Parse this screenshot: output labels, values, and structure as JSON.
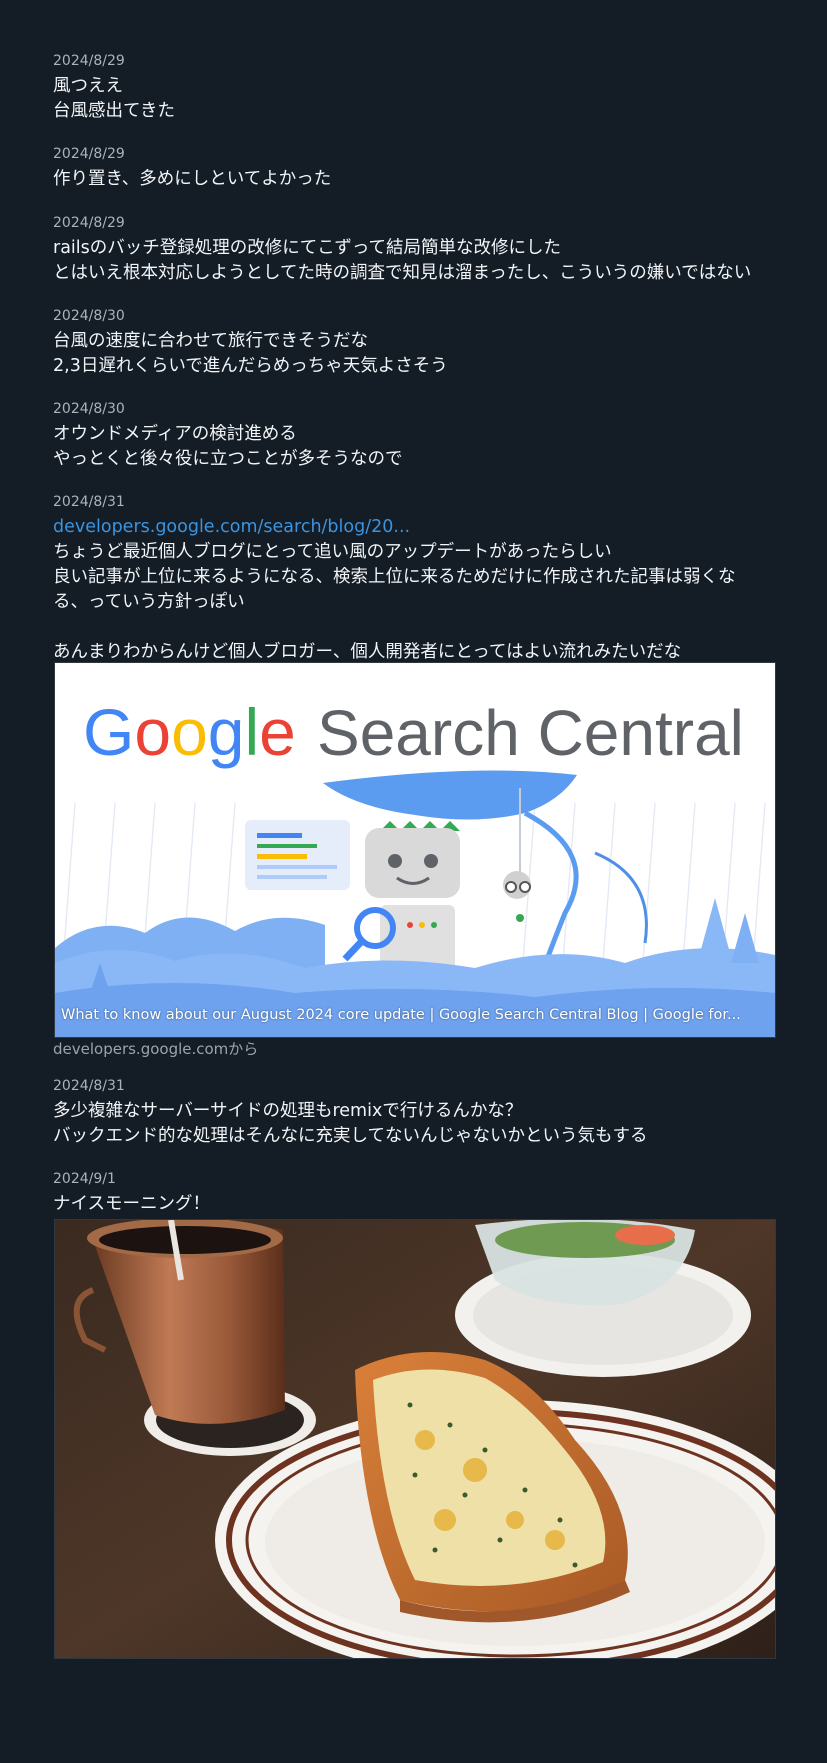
{
  "posts": [
    {
      "date": "2024/8/29",
      "text": "風つええ\n台風感出てきた"
    },
    {
      "date": "2024/8/29",
      "text": "作り置き、多めにしといてよかった"
    },
    {
      "date": "2024/8/29",
      "text": "railsのバッチ登録処理の改修にてこずって結局簡単な改修にした\nとはいえ根本対応しようとしてた時の調査で知見は溜まったし、こういうの嫌いではない"
    },
    {
      "date": "2024/8/30",
      "text": "台風の速度に合わせて旅行できそうだな\n2,3日遅れくらいで進んだらめっちゃ天気よさそう"
    },
    {
      "date": "2024/8/30",
      "text": "オウンドメディアの検討進める\nやっとくと後々役に立つことが多そうなので"
    },
    {
      "date": "2024/8/31",
      "link": "developers.google.com/search/blog/20...",
      "text": "ちょうど最近個人ブログにとって追い風のアップデートがあったらしい\n良い記事が上位に来るようになる、検索上位に来るためだけに作成された記事は弱くな\nる、っていう方針っぽい\n\nあんまりわからんけど個人ブロガー、個人開発者にとってはよい流れみたいだな"
    },
    {
      "date": "2024/8/31",
      "text": "多少複雑なサーバーサイドの処理もremixで行けるんかな？\nバックエンド的な処理はそんなに充実してないんじゃないかという気もする"
    },
    {
      "date": "2024/9/1",
      "text": "ナイスモーニング！"
    }
  ],
  "card": {
    "brand": "Google",
    "product": "Search Central",
    "title": "What to know about our August 2024 core update  |  Google Search Central Blog  |  Google for...",
    "source": "developers.google.comから"
  },
  "colors": {
    "background": "#141c25",
    "link": "#3b94e0",
    "date": "#a9b3bd"
  }
}
